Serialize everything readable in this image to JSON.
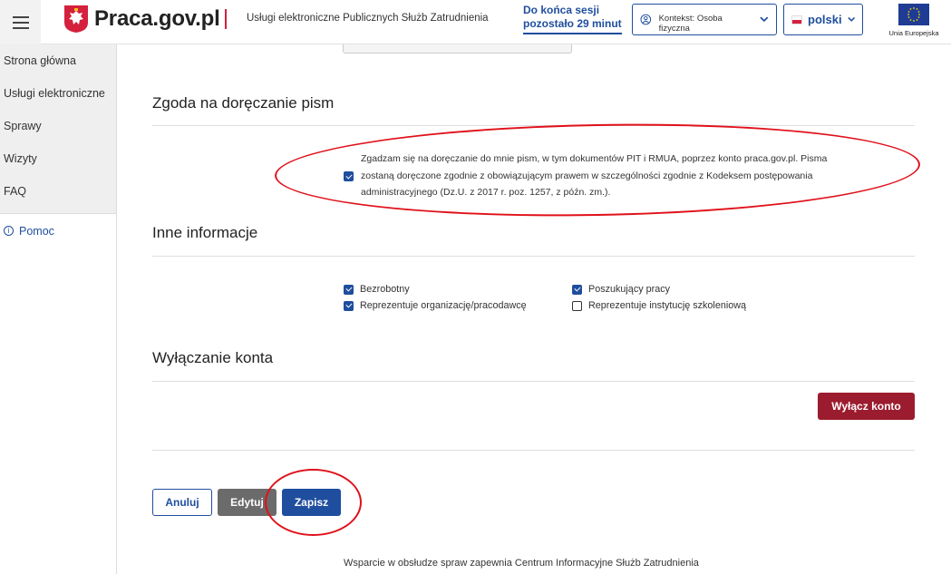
{
  "header": {
    "logo_text": "Praca.gov.pl",
    "subtitle": "Usługi elektroniczne Publicznych Służb Zatrudnienia",
    "session_line1": "Do końca sesji",
    "session_line2": "pozostało 29 minut",
    "context_label": "Kontekst:",
    "context_value": "Osoba fizyczna",
    "language": "polski",
    "eu_label": "Unia Europejska"
  },
  "sidebar": {
    "items": [
      {
        "label": "Strona główna"
      },
      {
        "label": "Usługi elektroniczne"
      },
      {
        "label": "Sprawy"
      },
      {
        "label": "Wizyty"
      },
      {
        "label": "FAQ"
      }
    ],
    "help_label": "Pomoc"
  },
  "sections": {
    "consent": {
      "title": "Zgoda na doręczanie pism",
      "checked": true,
      "text": "Zgadzam się na doręczanie do mnie pism, w tym dokumentów PIT i RMUA, poprzez konto praca.gov.pl. Pisma zostaną doręczone zgodnie z obowiązującym prawem w szczególności zgodnie z Kodeksem postępowania administracyjnego (Dz.U. z 2017 r. poz. 1257, z późn. zm.)."
    },
    "other_info": {
      "title": "Inne informacje",
      "options": [
        {
          "label": "Bezrobotny",
          "checked": true
        },
        {
          "label": "Poszukujący pracy",
          "checked": true
        },
        {
          "label": "Reprezentuje organizację/pracodawcę",
          "checked": true
        },
        {
          "label": "Reprezentuje instytucję szkoleniową",
          "checked": false
        }
      ]
    },
    "account_off": {
      "title": "Wyłączanie konta",
      "button": "Wyłącz konto"
    }
  },
  "actions": {
    "cancel": "Anuluj",
    "edit": "Edytuj",
    "save": "Zapisz"
  },
  "footer": {
    "text": "Wsparcie w obsłudze spraw zapewnia Centrum Informacyjne Służb Zatrudnienia"
  },
  "colors": {
    "primary": "#1f4e9e",
    "danger": "#9b1c2e",
    "annotation": "#e0101a"
  }
}
